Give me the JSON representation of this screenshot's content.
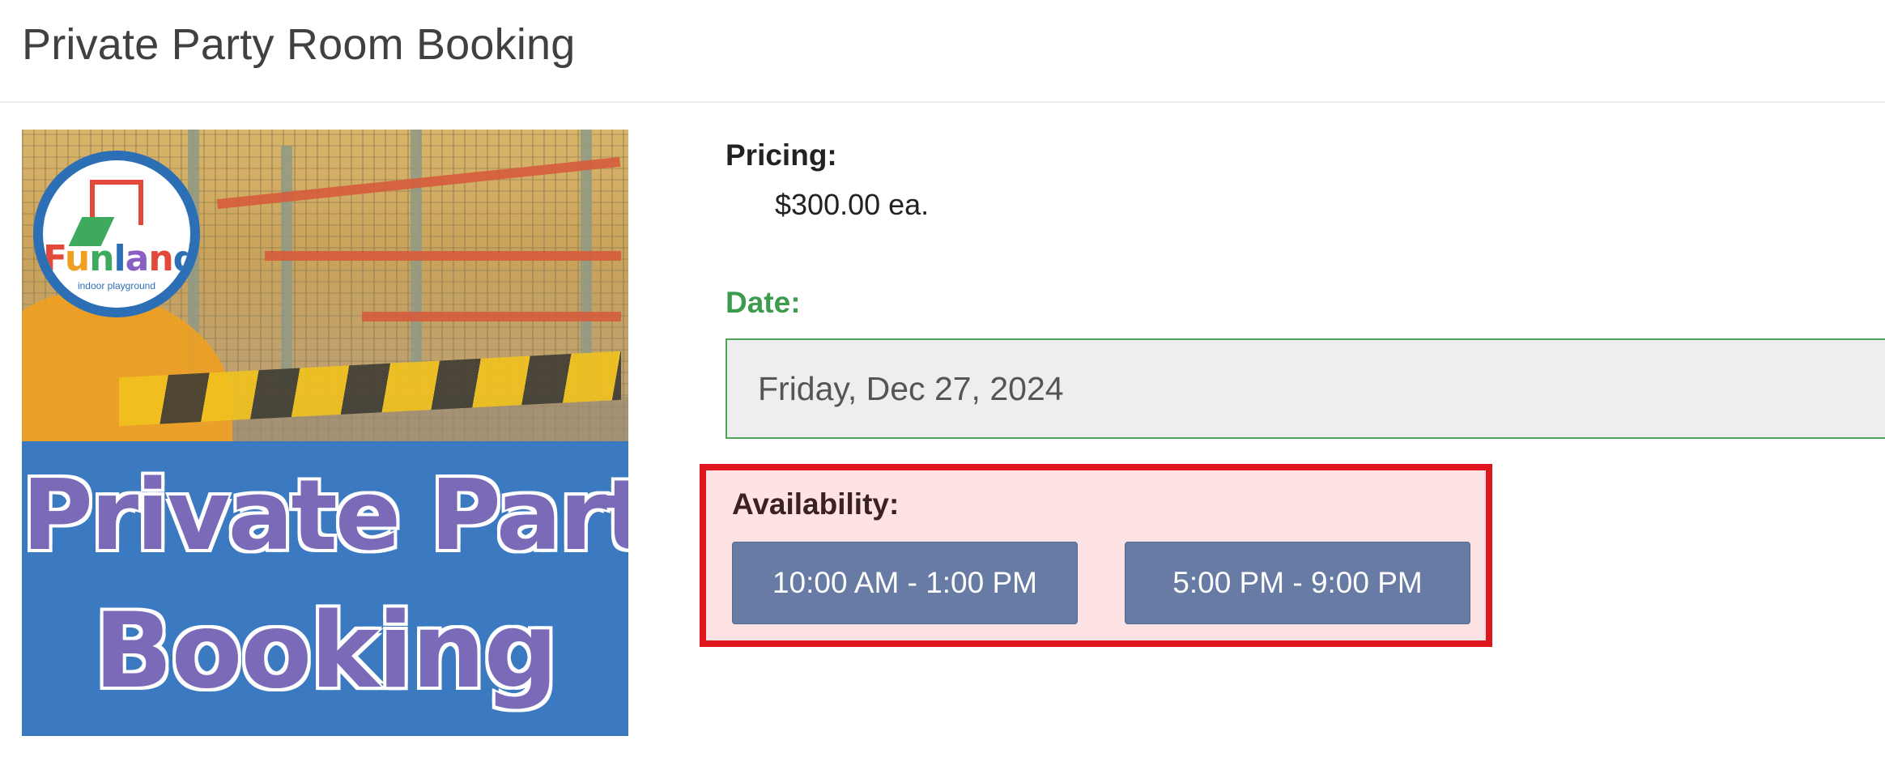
{
  "page": {
    "title": "Private Party Room Booking"
  },
  "promo_image": {
    "logo": {
      "word_letters": [
        "F",
        "u",
        "n",
        "l",
        "a",
        "n",
        "d"
      ],
      "subtitle": "indoor playground"
    },
    "line1": "Private Party",
    "line2": "Booking",
    "colors": {
      "banner_blue": "#3b7ac1",
      "text_purple": "#7b6ab8"
    }
  },
  "pricing": {
    "label": "Pricing:",
    "value": "$300.00 ea."
  },
  "date": {
    "label": "Date:",
    "value": "Friday, Dec 27, 2024",
    "accent_color": "#3d9b4e"
  },
  "availability": {
    "label": "Availability:",
    "slots": [
      {
        "label": "10:00 AM - 1:00 PM"
      },
      {
        "label": "5:00 PM - 9:00 PM"
      }
    ],
    "highlight_color": "#e0161f",
    "button_color": "#677ba4"
  }
}
